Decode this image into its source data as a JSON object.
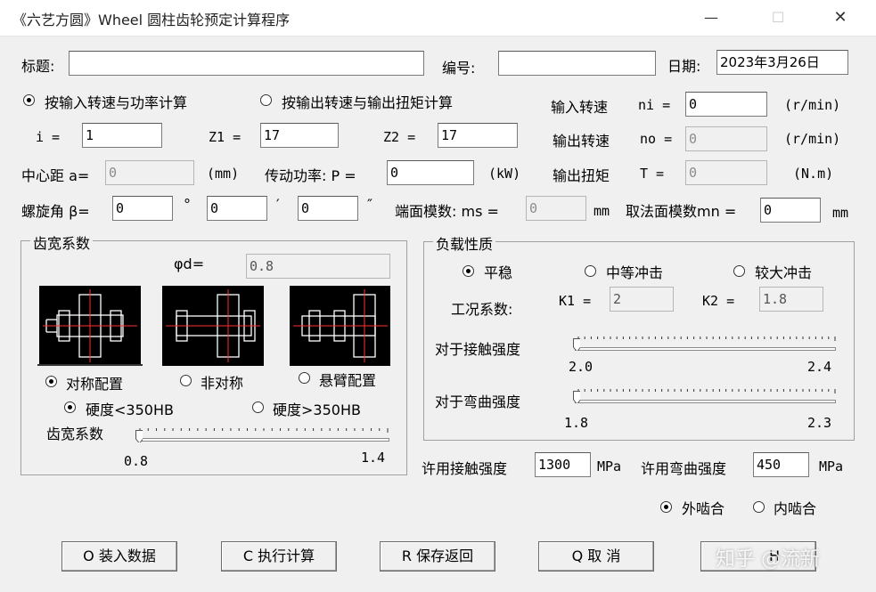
{
  "window": {
    "title": "《六艺方圆》Wheel 圆柱齿轮预定计算程序",
    "minimize": "—",
    "maximize": "☐",
    "close": "✕"
  },
  "row1": {
    "title_label": "标题:",
    "title_value": "",
    "number_label": "编号:",
    "number_value": "",
    "date_label": "日期:",
    "date_value": "2023年3月26日"
  },
  "mode": {
    "input_option": "按输入转速与功率计算",
    "output_option": "按输出转速与输出扭矩计算",
    "selected": "input"
  },
  "speeds": {
    "in_label": "输入转速",
    "in_sym": "ni =",
    "in_value": "0",
    "in_unit": "(r/min)",
    "out_label": "输出转速",
    "out_sym": "no =",
    "out_value": "0",
    "out_unit": "(r/min)",
    "torque_label": "输出扭矩",
    "torque_sym": "T =",
    "torque_value": "0",
    "torque_unit": "(N.m)"
  },
  "ratio": {
    "i_label": "i =",
    "i_value": "1",
    "z1_label": "Z1 =",
    "z1_value": "17",
    "z2_label": "Z2 =",
    "z2_value": "17"
  },
  "center": {
    "label": "中心距 a=",
    "value": "0",
    "unit": "(mm)",
    "power_label": "传动功率: P =",
    "power_value": "0",
    "power_unit": "(kW)"
  },
  "helix": {
    "label": "螺旋角 β=",
    "deg_value": "0",
    "deg_sym": "°",
    "min_value": "0",
    "min_sym": "′",
    "sec_value": "0",
    "sec_sym": "″",
    "ms_label": "端面模数: ms =",
    "ms_value": "0",
    "ms_unit": "mm",
    "mn_label": "取法面模数mn =",
    "mn_value": "0",
    "mn_unit": "mm"
  },
  "width": {
    "group_title": "齿宽系数",
    "phi_label": "φd=",
    "phi_value": "0.8",
    "config_sym": "对称配置",
    "config_asym": "非对称",
    "config_cant": "悬臂配置",
    "config_selected": "sym",
    "hard_low": "硬度<350HB",
    "hard_high": "硬度>350HB",
    "hard_selected": "low",
    "slider_label": "齿宽系数",
    "slider_min": "0.8",
    "slider_max": "1.4",
    "slider_level": 0
  },
  "load": {
    "group_title": "负载性质",
    "opt_smooth": "平稳",
    "opt_medium": "中等冲击",
    "opt_heavy": "较大冲击",
    "selected": "smooth",
    "factor_label": "工况系数:",
    "k1_label": "K1 =",
    "k1_value": "2",
    "k2_label": "K2 =",
    "k2_value": "1.8",
    "contact_label": "对于接触强度",
    "contact_min": "2.0",
    "contact_max": "2.4",
    "contact_level": 0,
    "bend_label": "对于弯曲强度",
    "bend_min": "1.8",
    "bend_max": "2.3",
    "bend_level": 0
  },
  "allow": {
    "contact_label": "许用接触强度",
    "contact_value": "1300",
    "contact_unit": "MPa",
    "bend_label": "许用弯曲强度",
    "bend_value": "450",
    "bend_unit": "MPa"
  },
  "mesh": {
    "external": "外啮合",
    "internal": "内啮合",
    "selected": "external"
  },
  "buttons": {
    "load": "O 装入数据",
    "calc": "C 执行计算",
    "save": "R 保存返回",
    "cancel": "Q 取  消",
    "help": "H"
  },
  "watermark": "知乎 @流新",
  "colors": {
    "gear_line": "#ffffff",
    "gear_axis": "#ff3030"
  }
}
